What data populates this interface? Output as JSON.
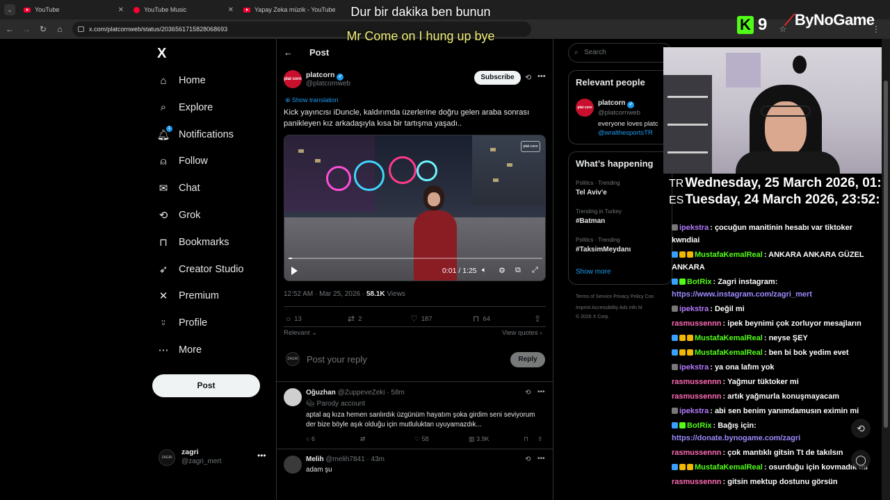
{
  "browser": {
    "tabs": [
      {
        "title": "YouTube"
      },
      {
        "title": "YouTube Music"
      },
      {
        "title": "Yapay Zeka müzik - YouTube"
      }
    ],
    "url": "x.com/platcornweb/status/2036561715828068693"
  },
  "subtitles": {
    "line1": "Dur bir dakika ben bunun",
    "line2": "Mr Come on I hung up bye"
  },
  "overlay": {
    "k_letter": "K",
    "k_number": "9",
    "brand": "ByNoGame",
    "brand_color": "#e02a2a",
    "kick_color": "#53fc18"
  },
  "sidebar": {
    "logo": "X",
    "items": [
      {
        "label": "Home",
        "icon": "home-icon"
      },
      {
        "label": "Explore",
        "icon": "search-icon"
      },
      {
        "label": "Notifications",
        "icon": "bell-icon",
        "badge": "1"
      },
      {
        "label": "Follow",
        "icon": "person-add-icon"
      },
      {
        "label": "Chat",
        "icon": "mail-icon"
      },
      {
        "label": "Grok",
        "icon": "grok-icon"
      },
      {
        "label": "Bookmarks",
        "icon": "bookmark-icon"
      },
      {
        "label": "Creator Studio",
        "icon": "rocket-icon"
      },
      {
        "label": "Premium",
        "icon": "x-icon"
      },
      {
        "label": "Profile",
        "icon": "person-icon"
      },
      {
        "label": "More",
        "icon": "more-circle-icon"
      }
    ],
    "post_button": "Post",
    "account": {
      "name": "zagri",
      "handle": "@zagri_mert",
      "avatar_text": "ZAGRI"
    }
  },
  "post": {
    "header_title": "Post",
    "author_name": "platcorn",
    "author_handle": "@platcornweb",
    "avatar_text": "plat corn",
    "subscribe": "Subscribe",
    "show_translation": "Show translation",
    "text": "Kick yayıncısı iDuncle, kaldırımda üzerlerine doğru gelen araba sonrası panikleyen kız arkadaşıyla kısa bir tartışma yaşadı..",
    "video": {
      "time": "0:01 / 1:25",
      "progress": 0.013,
      "watermark": "plat corn"
    },
    "timestamp": "12:52 AM · Mar 25, 2026 · ",
    "views_count": "58.1K",
    "views_label": " Views",
    "stats": {
      "replies": "13",
      "reposts": "2",
      "likes": "187",
      "bookmarks": "64"
    },
    "relevant": "Relevant",
    "view_quotes": "View quotes",
    "reply_placeholder": "Post your reply",
    "reply_button": "Reply"
  },
  "comments": [
    {
      "name": "Oğuzhan",
      "handle": "@ZuppeveZeki · 58m",
      "parody": "Parody account",
      "text": "aptal aq kıza hemen sanlırdık üzgünüm hayatım şoka girdim seni seviyorum der bize böyle aşık olduğu için mutluluktan uyuyamazdık...",
      "replies": "6",
      "likes": "58",
      "views": "3.9K"
    },
    {
      "name": "Melih",
      "handle": "@melih7841 · 43m",
      "text": "adam şu"
    }
  ],
  "right": {
    "search_placeholder": "Search",
    "relevant_title": "Relevant people",
    "person": {
      "name": "platcorn",
      "handle": "@platcornweb",
      "bio": "everyone loves platc",
      "link": "@wralthesportsTR",
      "avatar_text": "plat corn"
    },
    "happening_title": "What’s happening",
    "trends": [
      {
        "category": "Politics · Trending",
        "name": "Tel Aviv'e"
      },
      {
        "category": "Trending in Turkey",
        "name": "#Batman"
      },
      {
        "category": "Politics · Trending",
        "name": "#TaksimMeydanı"
      }
    ],
    "show_more": "Show more",
    "footer": {
      "line1": "Terms of Service    Privacy Policy    Coo",
      "line2": "Imprint    Accessibility    Ads info    M",
      "line3": "© 2026 X Corp."
    }
  },
  "clock": {
    "tr_label": "TR",
    "tr_time": "Wednesday, 25 March 2026, 01:",
    "es_label": "ES",
    "es_time": "Tuesday, 24 March 2026, 23:52:"
  },
  "chat": [
    {
      "user": "ipekstra",
      "color": "#b57bff",
      "text": "çocuğun manitinin hesabı var tiktoker kwndiai",
      "badges": [
        "#777777"
      ]
    },
    {
      "user": "MustafaKemalReal",
      "color": "#53fc18",
      "text": "ANKARA ANKARA GÜZEL ANKARA",
      "badges": [
        "#3aa0ff",
        "#f2b705",
        "#f2b705"
      ]
    },
    {
      "user": "BotRix",
      "color": "#53fc18",
      "text": "Zagri instagram:",
      "link": "https://www.instagram.com/zagri_mert",
      "badges": [
        "#3aa0ff",
        "#53fc18"
      ]
    },
    {
      "user": "ipekstra",
      "color": "#b57bff",
      "text": "Değil mi",
      "badges": [
        "#777777"
      ]
    },
    {
      "user": "rasmussennn",
      "color": "#ff6bb5",
      "text": "ipek beynimi çok zorluyor mesajların",
      "badges": []
    },
    {
      "user": "MustafaKemalReal",
      "color": "#53fc18",
      "text": "neyse ŞEY",
      "badges": [
        "#3aa0ff",
        "#f2b705",
        "#f2b705"
      ]
    },
    {
      "user": "MustafaKemalReal",
      "color": "#53fc18",
      "text": "ben bi bok yedim evet",
      "badges": [
        "#3aa0ff",
        "#f2b705",
        "#f2b705"
      ]
    },
    {
      "user": "ipekstra",
      "color": "#b57bff",
      "text": "ya ona lafım yok",
      "badges": [
        "#777777"
      ]
    },
    {
      "user": "rasmussennn",
      "color": "#ff6bb5",
      "text": "Yağmur tüktoker mi",
      "badges": []
    },
    {
      "user": "rasmussennn",
      "color": "#ff6bb5",
      "text": "artık yağmurla konuşmayacam",
      "badges": []
    },
    {
      "user": "ipekstra",
      "color": "#b57bff",
      "text": "abi sen benim yanımdamusın eximin mi",
      "badges": [
        "#777777"
      ]
    },
    {
      "user": "BotRix",
      "color": "#53fc18",
      "text": "Bağış için:",
      "link": "https://donate.bynogame.com/zagri",
      "badges": [
        "#3aa0ff",
        "#53fc18"
      ]
    },
    {
      "user": "rasmussennn",
      "color": "#ff6bb5",
      "text": "çok mantıklı gitsin Tt de takılsın",
      "badges": []
    },
    {
      "user": "MustafaKemalReal",
      "color": "#53fc18",
      "text": "osurduğu için kovmadık mı",
      "badges": [
        "#3aa0ff",
        "#f2b705",
        "#f2b705"
      ]
    },
    {
      "user": "rasmussennn",
      "color": "#ff6bb5",
      "text": "gitsin mektup dostunu görsün",
      "badges": []
    }
  ]
}
